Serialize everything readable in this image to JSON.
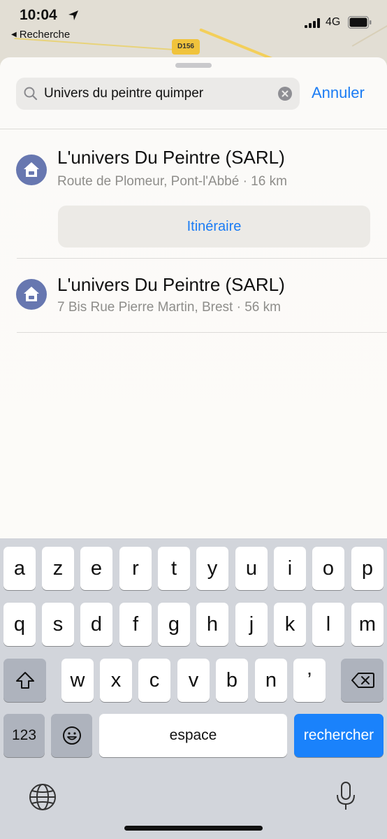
{
  "status_bar": {
    "time": "10:04",
    "back_label": "Recherche",
    "network": "4G"
  },
  "map": {
    "road_shield": "D156"
  },
  "search": {
    "query": "Univers du peintre quimper",
    "cancel_label": "Annuler"
  },
  "results": [
    {
      "title": "L'univers Du Peintre (SARL)",
      "subtitle": "Route de Plomeur, Pont-l'Abbé · 16 km",
      "action_label": "Itinéraire",
      "icon": "home-repair-icon"
    },
    {
      "title": "L'univers Du Peintre (SARL)",
      "subtitle": "7 Bis Rue Pierre Martin, Brest · 56 km",
      "icon": "home-repair-icon"
    }
  ],
  "keyboard": {
    "row1": [
      "a",
      "z",
      "e",
      "r",
      "t",
      "y",
      "u",
      "i",
      "o",
      "p"
    ],
    "row2": [
      "q",
      "s",
      "d",
      "f",
      "g",
      "h",
      "j",
      "k",
      "l",
      "m"
    ],
    "row3": [
      "w",
      "x",
      "c",
      "v",
      "b",
      "n",
      "’"
    ],
    "numbers_label": "123",
    "space_label": "espace",
    "return_label": "rechercher"
  },
  "colors": {
    "accent": "#1b7cf4",
    "result_icon_bg": "#6777b0",
    "return_key": "#1a82fb"
  }
}
